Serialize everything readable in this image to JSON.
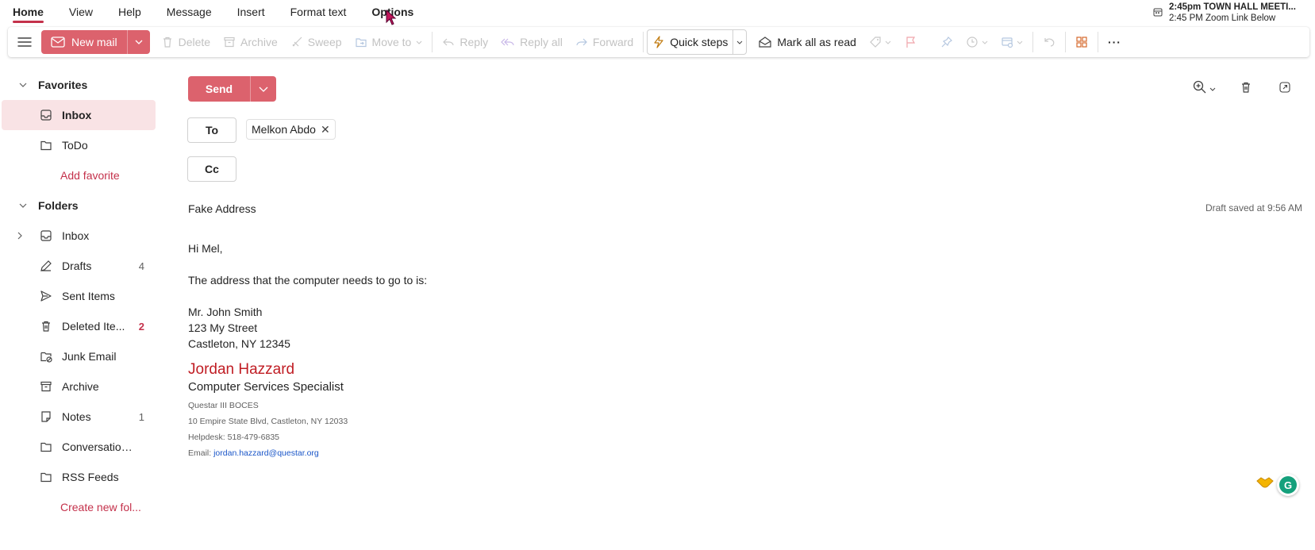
{
  "tabs": [
    {
      "label": "Home"
    },
    {
      "label": "View"
    },
    {
      "label": "Help"
    },
    {
      "label": "Message"
    },
    {
      "label": "Insert"
    },
    {
      "label": "Format text"
    },
    {
      "label": "Options"
    }
  ],
  "reminder": {
    "line1": "2:45pm TOWN HALL MEETI...",
    "line2": "2:45 PM Zoom Link Below"
  },
  "ribbon": {
    "new_mail": "New mail",
    "delete": "Delete",
    "archive": "Archive",
    "sweep": "Sweep",
    "move_to": "Move to",
    "reply": "Reply",
    "reply_all": "Reply all",
    "forward": "Forward",
    "quick_steps": "Quick steps",
    "mark_all_read": "Mark all as read",
    "more": "···"
  },
  "sidebar": {
    "favorites_label": "Favorites",
    "favorites": [
      {
        "label": "Inbox",
        "icon": "inbox-icon"
      },
      {
        "label": "ToDo",
        "icon": "folder-icon"
      }
    ],
    "add_favorite": "Add favorite",
    "folders_label": "Folders",
    "folders": [
      {
        "label": "Inbox",
        "count": "",
        "icon": "inbox-icon"
      },
      {
        "label": "Drafts",
        "count": "4",
        "icon": "pencil-icon"
      },
      {
        "label": "Sent Items",
        "count": "",
        "icon": "send-icon"
      },
      {
        "label": "Deleted Ite...",
        "count": "2",
        "icon": "trash-icon"
      },
      {
        "label": "Junk Email",
        "count": "",
        "icon": "junk-icon"
      },
      {
        "label": "Archive",
        "count": "",
        "icon": "archive-icon"
      },
      {
        "label": "Notes",
        "count": "1",
        "icon": "notes-icon"
      },
      {
        "label": "Conversation ...",
        "count": "",
        "icon": "folder-icon"
      },
      {
        "label": "RSS Feeds",
        "count": "",
        "icon": "folder-icon"
      }
    ],
    "create_folder": "Create new fol..."
  },
  "compose": {
    "send": "Send",
    "to_label": "To",
    "to_recipient": "Melkon Abdo",
    "cc_label": "Cc",
    "subject": "Fake Address",
    "draft_status": "Draft saved at 9:56 AM",
    "greeting": "Hi Mel,",
    "line1": "The address that the computer needs to go to is:",
    "addr1": "Mr. John Smith",
    "addr2": "123 My Street",
    "addr3": "Castleton, NY 12345",
    "sig_name": "Jordan Hazzard",
    "sig_title": "Computer Services Specialist",
    "sig_org": "Questar III BOCES",
    "sig_address": "10 Empire State Blvd, Castleton, NY 12033",
    "sig_helpdesk": "Helpdesk: 518-479-6835",
    "sig_email_label": "Email: ",
    "sig_email": "jordan.hazzard@questar.org"
  },
  "colors": {
    "accent": "#c4314b",
    "send": "#dc626d",
    "selected_bg": "#f9e3e5",
    "sig_name": "#c01d24"
  }
}
